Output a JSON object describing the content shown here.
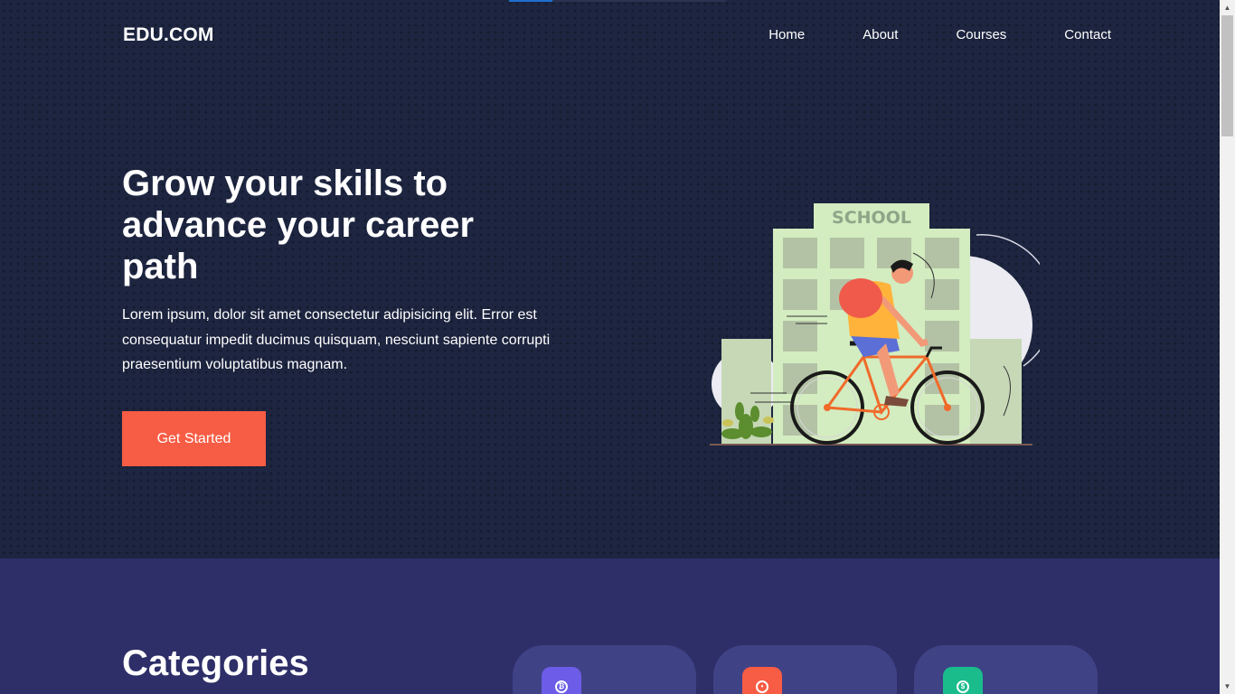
{
  "header": {
    "brand": "EDU.COM",
    "nav": [
      "Home",
      "About",
      "Courses",
      "Contact"
    ]
  },
  "hero": {
    "title": "Grow your skills to advance your career path",
    "description": "Lorem ipsum, dolor sit amet consectetur adipisicing elit. Error est consequatur impedit ducimus quisquam, nesciunt sapiente corrupti praesentium voluptatibus magnam.",
    "cta_label": "Get Started",
    "illustration_sign": "SCHOOL"
  },
  "categories": {
    "title": "Categories",
    "cards": [
      {
        "icon": "bitcoin-icon",
        "color": "#6c5ce7"
      },
      {
        "icon": "palette-icon",
        "color": "#f75c44"
      },
      {
        "icon": "dollar-icon",
        "color": "#1abc8c"
      }
    ]
  },
  "colors": {
    "hero_bg": "#1d2540",
    "categories_bg": "#2e2e68",
    "accent": "#f75c44",
    "card_bg": "#404286"
  }
}
